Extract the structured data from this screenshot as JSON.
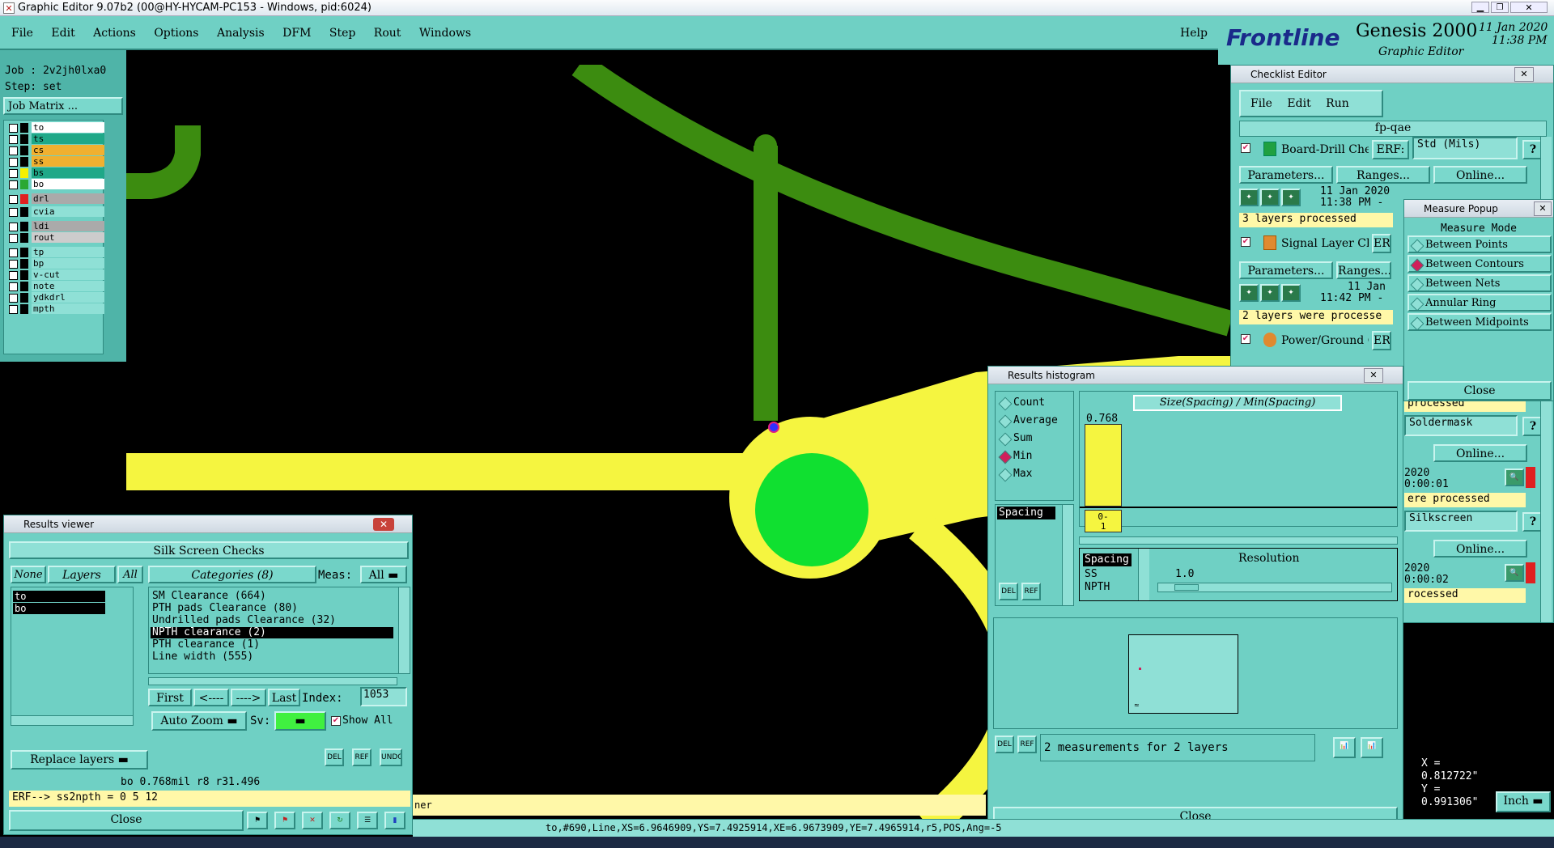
{
  "window": {
    "title": "Graphic Editor 9.07b2 (00@HY-HYCAM-PC153 - Windows, pid:6024)"
  },
  "menu": {
    "items": [
      "File",
      "Edit",
      "Actions",
      "Options",
      "Analysis",
      "DFM",
      "Step",
      "Rout",
      "Windows"
    ],
    "help": "Help"
  },
  "brand": {
    "logo": "Frontline",
    "product": "Genesis 2000",
    "subtitle": "Graphic Editor",
    "date": "11 Jan 2020",
    "time": "11:38 PM"
  },
  "job": {
    "job_label": "Job : 2v2jh0lxa0",
    "step_label": "Step: set",
    "matrix_button": "Job Matrix ..."
  },
  "layers": [
    {
      "name": "to",
      "color": "#ffffff",
      "swatch": "#000000"
    },
    {
      "name": "ts",
      "color": "#1fa888",
      "swatch": "#000000"
    },
    {
      "name": "cs",
      "color": "#f0b030",
      "swatch": "#000000"
    },
    {
      "name": "ss",
      "color": "#f0b030",
      "swatch": "#000000"
    },
    {
      "name": "bs",
      "color": "#1fa888",
      "swatch": "#f5f000"
    },
    {
      "name": "bo",
      "color": "#ffffff",
      "swatch": "#2aa832"
    },
    {
      "name": "drl",
      "color": "#aaaaaa",
      "swatch": "#e02020"
    },
    {
      "name": "cvia",
      "color": "#8fe0d6",
      "swatch": "#000000"
    },
    {
      "name": "ldi",
      "color": "#aaaaaa",
      "swatch": "#000000"
    },
    {
      "name": "rout",
      "color": "#cccccc",
      "swatch": "#000000"
    },
    {
      "name": "tp",
      "color": "#8fe0d6",
      "swatch": "#000000"
    },
    {
      "name": "bp",
      "color": "#8fe0d6",
      "swatch": "#000000"
    },
    {
      "name": "v-cut",
      "color": "#8fe0d6",
      "swatch": "#000000"
    },
    {
      "name": "note",
      "color": "#8fe0d6",
      "swatch": "#000000"
    },
    {
      "name": "ydkdrl",
      "color": "#8fe0d6",
      "swatch": "#000000"
    },
    {
      "name": "mpth",
      "color": "#8fe0d6",
      "swatch": "#000000"
    }
  ],
  "checklist": {
    "title": "Checklist Editor",
    "menu": [
      "File",
      "Edit",
      "Run"
    ],
    "name": "fp-qae",
    "erf_label": "ERF:",
    "erf_value": "Std (Mils)",
    "parameters": "Parameters...",
    "ranges": "Ranges...",
    "online": "Online...",
    "items": [
      {
        "name": "Board-Drill Che",
        "date": "11 Jan 2020",
        "time": "11:38 PM -",
        "status": "3 layers processed"
      },
      {
        "name": "Signal Layer Ch",
        "erf": "ERF",
        "date": "11 Jan",
        "time": "11:42 PM -",
        "status": "2 layers were processe"
      },
      {
        "name": "Power/Ground C",
        "erf": "ERF"
      }
    ],
    "right_items": [
      {
        "erf": "Soldermask",
        "time": "2020",
        "elapsed": "0:00:01",
        "status": "ere processed"
      },
      {
        "erf": "Silkscreen",
        "time": "2020",
        "elapsed": "0:00:02",
        "status": "rocessed"
      }
    ],
    "processed_partial": "processed"
  },
  "measure": {
    "title": "Measure Popup",
    "header": "Measure Mode",
    "modes": [
      "Between Points",
      "Between Contours",
      "Between Nets",
      "Annular Ring",
      "Between Midpoints"
    ],
    "selected": "Between Contours",
    "close": "Close"
  },
  "histogram": {
    "title": "Results histogram",
    "stats": [
      "Count",
      "Average",
      "Sum",
      "Min",
      "Max"
    ],
    "selected_stat": "Min",
    "chart_title": "Size(Spacing) / Min(Spacing)",
    "bar_value": "0.768",
    "bin_label": "0-\n1",
    "list_item": "Spacing",
    "attrs": [
      "Spacing",
      "SS",
      "NPTH"
    ],
    "resolution_label": "Resolution",
    "resolution_value": "1.0",
    "status": "2 measurements for 2 layers",
    "close": "Close",
    "del": "DEL",
    "ref": "REF"
  },
  "results": {
    "title": "Results viewer",
    "header": "Silk Screen Checks",
    "none": "None",
    "layers": "Layers",
    "all": "All",
    "categories": "Categories (8)",
    "meas_label": "Meas:",
    "meas_value": "All",
    "layer_list": [
      "to",
      "bo"
    ],
    "category_list": [
      "SM Clearance (664)",
      "PTH pads Clearance (80)",
      "Undrilled pads Clearance (32)",
      "NPTH clearance (2)",
      "PTH clearance (1)",
      "Line width (555)"
    ],
    "selected_category": "NPTH clearance (2)",
    "first": "First",
    "prev": "<----",
    "next": "---->",
    "last": "Last",
    "index_label": "Index:",
    "index_value": "1053",
    "auto_zoom": "Auto Zoom",
    "sv_label": "Sv:",
    "show_all": "Show All",
    "replace_layers": "Replace layers",
    "info": "bo 0.768mil  r8  r31.496",
    "erf": "ERF--> ss2npth = 0 5 12",
    "close": "Close",
    "del": "DEL",
    "ref": "REF",
    "undo": "UNDO"
  },
  "statusbar": {
    "text": "to,#690,Line,XS=6.9646909,YS=7.4925914,XE=6.9673909,YE=7.4965914,r5,POS,Ang=-5",
    "partial": "ner",
    "coord_x": "X = 0.812722\"",
    "coord_y": "Y = 0.991306\"",
    "units": "Inch"
  }
}
